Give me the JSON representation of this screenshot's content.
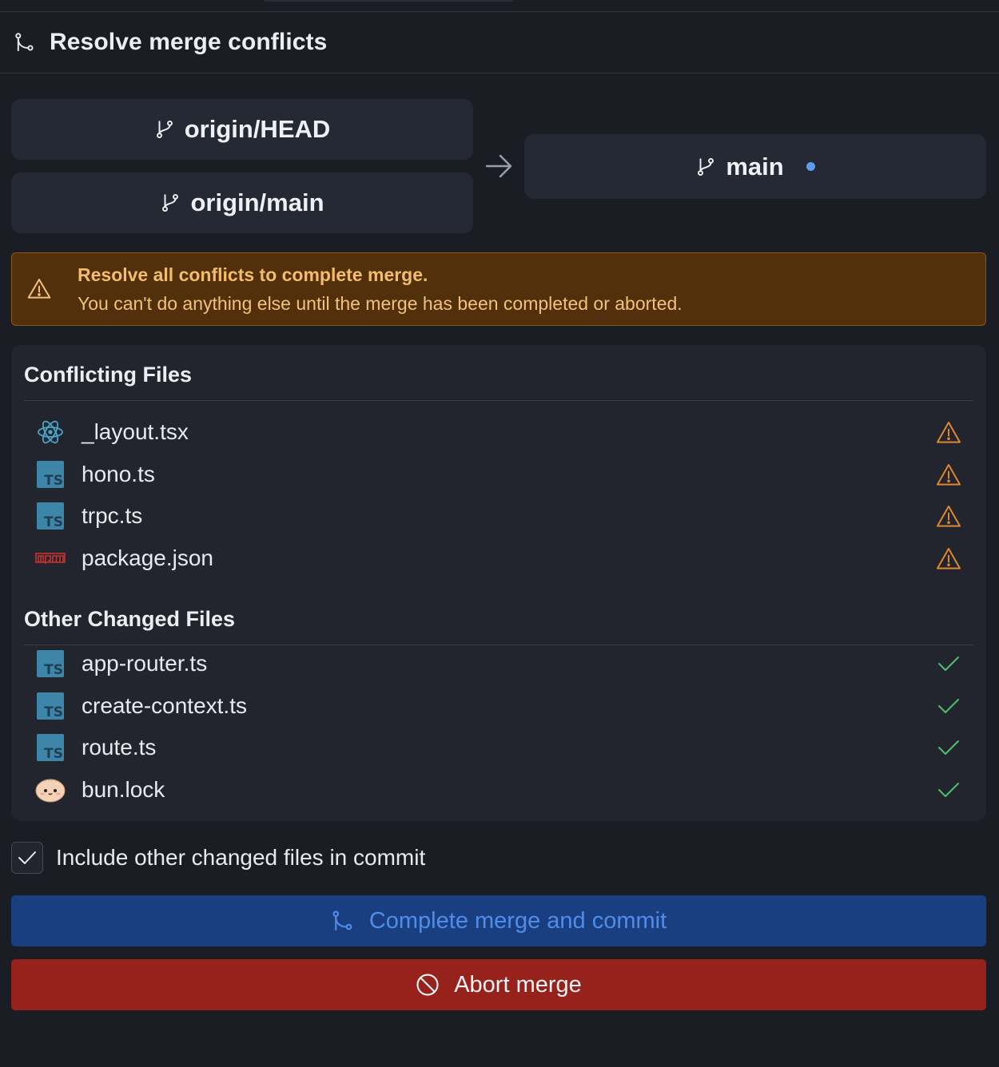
{
  "header": {
    "title": "Resolve merge conflicts",
    "icon": "git-merge-icon"
  },
  "branches": {
    "sources": [
      {
        "label": "origin/HEAD",
        "icon": "git-branch-icon"
      },
      {
        "label": "origin/main",
        "icon": "git-branch-icon"
      }
    ],
    "target": {
      "label": "main",
      "icon": "git-branch-icon",
      "status_dot_color": "#5b9cf0"
    }
  },
  "warning": {
    "title": "Resolve all conflicts to complete merge.",
    "message": "You can't do anything else until the merge has been completed or aborted.",
    "icon": "warning-icon"
  },
  "conflicting": {
    "title": "Conflicting Files",
    "files": [
      {
        "name": "_layout.tsx",
        "icon": "react-icon",
        "status": "conflict"
      },
      {
        "name": "hono.ts",
        "icon": "typescript-icon",
        "status": "conflict"
      },
      {
        "name": "trpc.ts",
        "icon": "typescript-icon",
        "status": "conflict"
      },
      {
        "name": "package.json",
        "icon": "npm-icon",
        "status": "conflict"
      }
    ]
  },
  "other": {
    "title": "Other Changed Files",
    "files": [
      {
        "name": "app-router.ts",
        "icon": "typescript-icon",
        "status": "ok"
      },
      {
        "name": "create-context.ts",
        "icon": "typescript-icon",
        "status": "ok"
      },
      {
        "name": "route.ts",
        "icon": "typescript-icon",
        "status": "ok"
      },
      {
        "name": "bun.lock",
        "icon": "bun-icon",
        "status": "ok"
      }
    ]
  },
  "include_other": {
    "label": "Include other changed files in commit",
    "checked": true
  },
  "actions": {
    "complete_label": "Complete merge and commit",
    "abort_label": "Abort merge"
  },
  "colors": {
    "background": "#1a1d24",
    "warning_bg": "#52300c",
    "warning_text": "#f3bd6c",
    "conflict_icon": "#e0862f",
    "ok_icon": "#4fbf68",
    "complete_button": "#1a3f80",
    "abort_button": "#97211b"
  }
}
